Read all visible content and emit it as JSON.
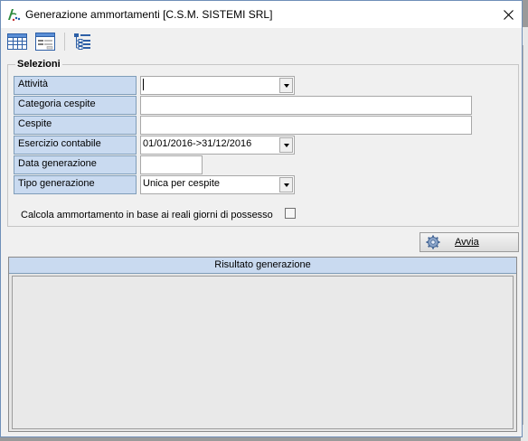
{
  "window": {
    "title": "Generazione ammortamenti [C.S.M. SISTEMI SRL]",
    "close_glyph": "✕"
  },
  "toolbar": {
    "buttons": [
      {
        "name": "grid-view-button",
        "icon": "table-grid-icon"
      },
      {
        "name": "form-view-button",
        "icon": "form-window-icon"
      },
      {
        "name": "tree-view-button",
        "icon": "tree-list-icon"
      }
    ]
  },
  "selezioni": {
    "title": "Selezioni",
    "fields": {
      "attivita": {
        "label": "Attività",
        "value": "",
        "type": "combo"
      },
      "categoria_cespite": {
        "label": "Categoria cespite",
        "value": "",
        "type": "text"
      },
      "cespite": {
        "label": "Cespite",
        "value": "",
        "type": "text"
      },
      "esercizio_contabile": {
        "label": "Esercizio contabile",
        "value": "01/01/2016->31/12/2016",
        "type": "combo"
      },
      "data_generazione": {
        "label": "Data generazione",
        "value": "",
        "type": "text"
      },
      "tipo_generazione": {
        "label": "Tipo generazione",
        "value": "Unica per cespite",
        "type": "combo"
      }
    },
    "checkbox": {
      "label": "Calcola ammortamento in base ai reali giorni di possesso",
      "checked": false
    }
  },
  "actions": {
    "avvia": {
      "label": "Avvia",
      "icon": "gear-icon"
    }
  },
  "result": {
    "header": "Risultato generazione",
    "rows": []
  },
  "colors": {
    "label_bg": "#c9daf0",
    "label_border": "#7f9db9",
    "window_bg": "#f0f0f0"
  }
}
